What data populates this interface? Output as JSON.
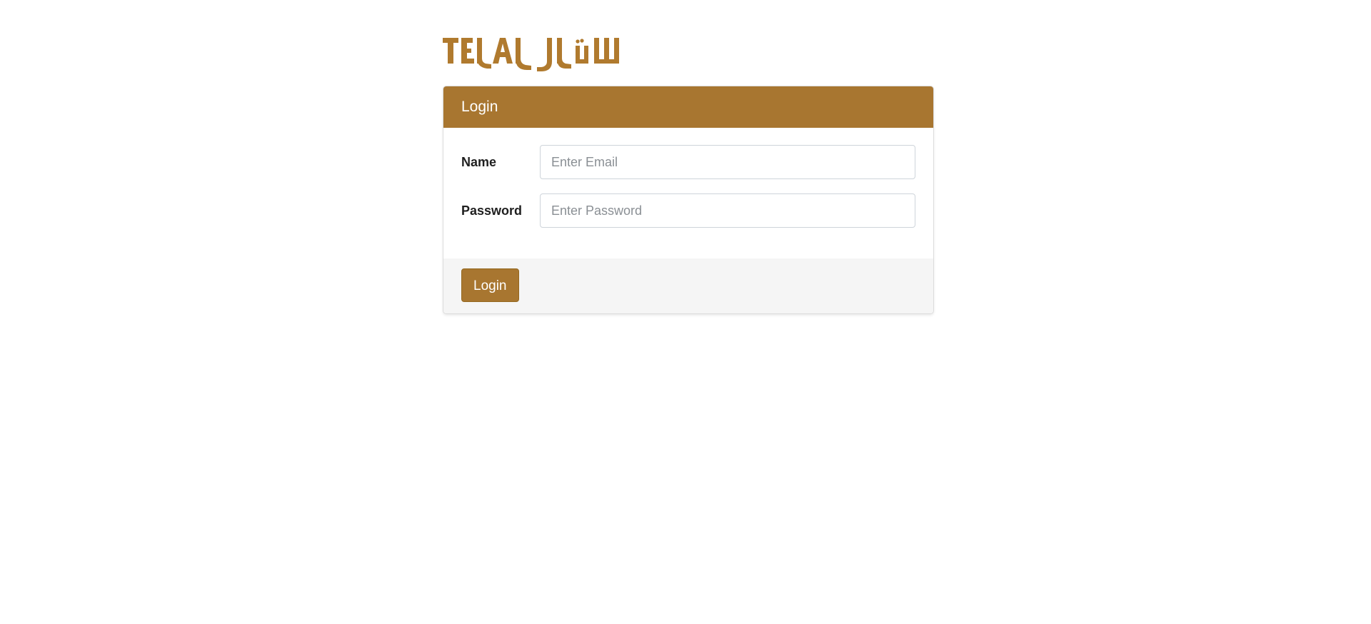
{
  "logo": {
    "text": "TELAL تلال",
    "color": "#b07a2e"
  },
  "login_card": {
    "header_title": "Login",
    "accent_color": "#a87630",
    "fields": {
      "name": {
        "label": "Name",
        "placeholder": "Enter Email",
        "value": ""
      },
      "password": {
        "label": "Password",
        "placeholder": "Enter Password",
        "value": ""
      }
    },
    "submit_label": "Login"
  }
}
